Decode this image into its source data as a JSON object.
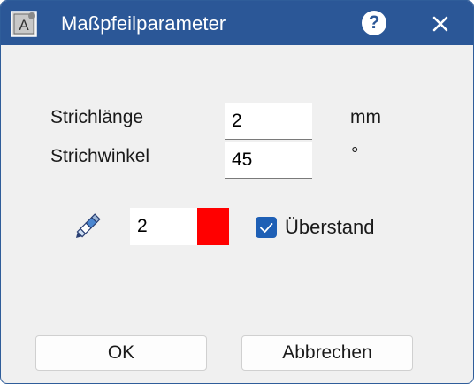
{
  "window": {
    "title": "Maßpfeilparameter",
    "app_icon": "letter-a-doc-icon",
    "help_icon": "help-icon",
    "close_icon": "close-icon",
    "help_glyph": "?",
    "titlebar_color": "#2b5797"
  },
  "fields": {
    "stroke_length": {
      "label": "Strichlänge",
      "value": "2",
      "unit": "mm"
    },
    "stroke_angle": {
      "label": "Strichwinkel",
      "value": "45",
      "unit": "°"
    }
  },
  "pen": {
    "icon": "pen-icon",
    "value": "2",
    "color": "#ff0000"
  },
  "overhang": {
    "label": "Überstand",
    "checked": true
  },
  "buttons": {
    "ok": "OK",
    "cancel": "Abbrechen"
  }
}
